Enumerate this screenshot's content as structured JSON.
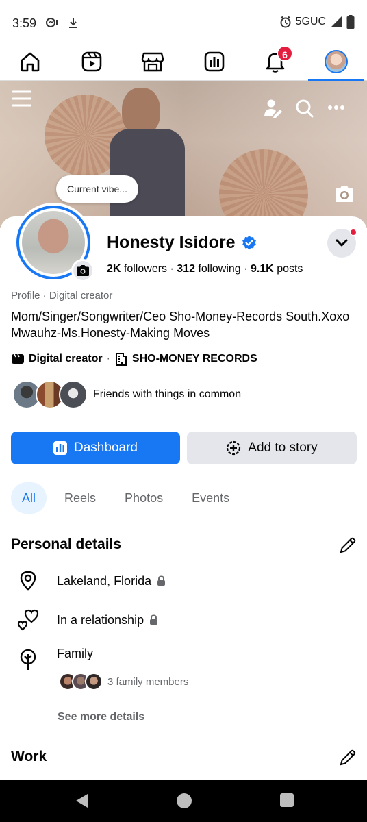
{
  "status_bar": {
    "time": "3:59",
    "network": "5GUC"
  },
  "nav": {
    "notifications_badge": "6",
    "items": [
      "home",
      "reels",
      "marketplace",
      "dashboard",
      "notifications",
      "profile"
    ]
  },
  "cover": {
    "vibe_prompt": "Current vibe..."
  },
  "profile": {
    "name": "Honesty Isidore",
    "followers_count": "2K",
    "followers_label": "followers",
    "following_count": "312",
    "following_label": "following",
    "posts_count": "9.1K",
    "posts_label": "posts",
    "separator": "·",
    "profile_type": "Profile · Digital creator",
    "bio": "Mom/Singer/Songwriter/Ceo Sho-Money-Records South.Xoxo Mwauhz-Ms.Honesty-Making Moves",
    "category": "Digital creator",
    "workplace": "SHO-MONEY RECORDS",
    "friends_text": "Friends with things in common"
  },
  "actions": {
    "primary": "Dashboard",
    "secondary": "Add to story"
  },
  "tabs": [
    {
      "label": "All",
      "active": true
    },
    {
      "label": "Reels",
      "active": false
    },
    {
      "label": "Photos",
      "active": false
    },
    {
      "label": "Events",
      "active": false
    }
  ],
  "personal_details": {
    "title": "Personal details",
    "location": "Lakeland, Florida",
    "relationship": "In a relationship",
    "family_label": "Family",
    "family_members": "3 family members",
    "see_more": "See more details"
  },
  "work": {
    "title": "Work"
  },
  "colors": {
    "accent": "#1877f2",
    "badge": "#e41e3f",
    "secondary_bg": "#e4e6eb"
  }
}
